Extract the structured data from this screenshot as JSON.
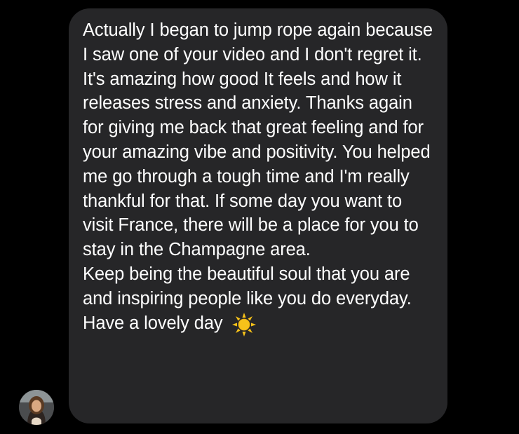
{
  "sender": {
    "avatar_icon": "profile-photo-avatar"
  },
  "message": {
    "paragraphs": [
      "Actually I began to jump rope again because I saw one of your video and I don't regret it. It's amazing how good It feels and how it releases stress and anxiety. Thanks again for giving me back that great feeling and for your amazing vibe and positivity. You helped me go through a tough time and I'm really thankful for that. If some day you want to visit France, there will be a place for you to stay in the Champagne area.",
      "Keep being the beautiful soul that you are and inspiring people like you do everyday."
    ],
    "closing": "Have a lovely day",
    "closing_emoji_icon": "sun-emoji-icon"
  },
  "colors": {
    "background": "#000000",
    "bubble": "#262628",
    "text": "#ffffff",
    "sun": "#f7c21a"
  }
}
